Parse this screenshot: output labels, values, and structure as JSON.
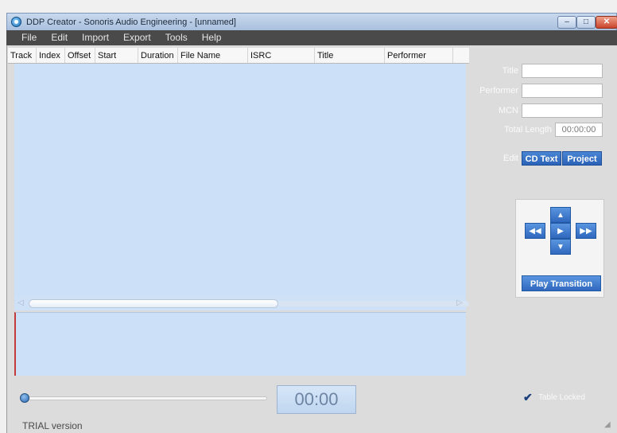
{
  "window": {
    "title": "DDP Creator - Sonoris Audio Engineering - [unnamed]",
    "min_glyph": "–",
    "max_glyph": "□",
    "close_glyph": "✕"
  },
  "menu": [
    "File",
    "Edit",
    "Import",
    "Export",
    "Tools",
    "Help"
  ],
  "table": {
    "columns": [
      "Track",
      "Index",
      "Offset",
      "Start",
      "Duration",
      "File Name",
      "ISRC",
      "Title",
      "Performer",
      ""
    ],
    "rows": []
  },
  "right_panel": {
    "title_label": "Title",
    "performer_label": "Performer",
    "mcn_label": "MCN",
    "total_length_label": "Total Length",
    "total_length_value": "00:00:00",
    "edit_label": "Edit",
    "cd_text_button": "CD Text",
    "project_button": "Project",
    "play_transition_button": "Play Transition"
  },
  "transport": {
    "up": "▲",
    "down": "▼",
    "rewind": "◀◀",
    "play": "▶",
    "forward": "▶▶"
  },
  "bottom": {
    "time_display": "00:00",
    "trial_text": "TRIAL version",
    "table_locked_label": "Table Locked",
    "table_locked": true
  },
  "colors": {
    "menubar_bg": "#4a4a4a",
    "table_bg": "#cce0f8",
    "button_blue": "#2f68bd",
    "panel_gray": "#dcdcdc"
  }
}
